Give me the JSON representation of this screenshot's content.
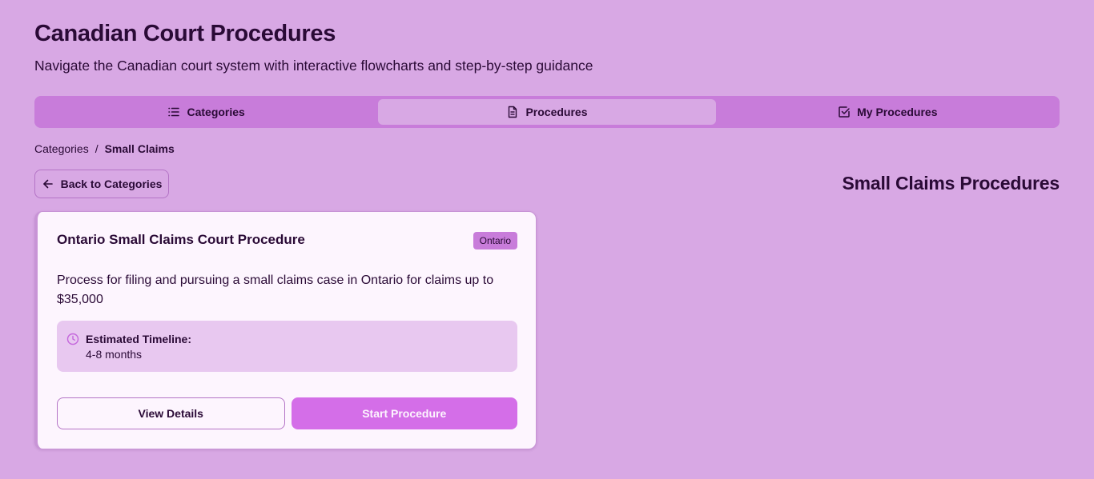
{
  "header": {
    "title": "Canadian Court Procedures",
    "subtitle": "Navigate the Canadian court system with interactive flowcharts and step-by-step guidance"
  },
  "tabs": [
    {
      "label": "Categories",
      "icon": "list-icon",
      "active": false
    },
    {
      "label": "Procedures",
      "icon": "file-icon",
      "active": true
    },
    {
      "label": "My Procedures",
      "icon": "checkbox-icon",
      "active": false
    }
  ],
  "breadcrumb": {
    "root": "Categories",
    "separator": "/",
    "current": "Small Claims"
  },
  "back_button": {
    "label": "Back to Categories",
    "icon": "arrow-left-icon"
  },
  "section_title": "Small Claims Procedures",
  "card": {
    "title": "Ontario Small Claims Court Procedure",
    "badge": "Ontario",
    "description": "Process for filing and pursuing a small claims case in Ontario for claims up to $35,000",
    "timeline_label": "Estimated Timeline:",
    "timeline_value": "4-8 months",
    "timeline_icon": "clock-icon",
    "view_details_label": "View Details",
    "start_label": "Start Procedure"
  },
  "colors": {
    "background": "#d8a8e4",
    "tab_bar": "#c87cda",
    "card": "#fdf5fe",
    "primary_button": "#d46ee8",
    "text": "#2a0a36"
  }
}
